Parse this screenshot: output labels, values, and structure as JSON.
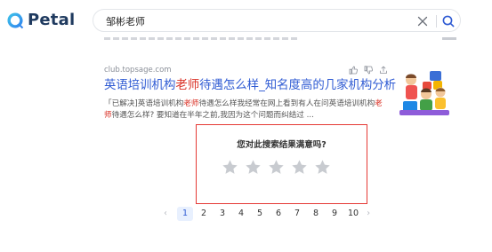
{
  "header": {
    "logo_text": "Petal",
    "search_value": "邹彬老师"
  },
  "result": {
    "url": "club.topsage.com",
    "title_pre": "英语培训机构",
    "title_hl": "老师",
    "title_post": "待遇怎么样_知名度高的几家机构分析",
    "snippet_pre": "「已解决]英语培训机构",
    "snippet_hl1": "老师",
    "snippet_mid": "待遇怎么样我经常在网上看到有人在问英语培训机构",
    "snippet_hl2": "老师",
    "snippet_post": "待遇怎么样? 要知道在半年之前,我因为这个问题而纠结过 ..."
  },
  "survey": {
    "question": "您对此搜索结果满意吗?",
    "star_count": 5,
    "star_color": "#c8cbd0"
  },
  "pagination": {
    "prev": "‹",
    "pages": [
      "1",
      "2",
      "3",
      "4",
      "5",
      "6",
      "7",
      "8",
      "9",
      "10"
    ],
    "current": "1",
    "next": "›"
  },
  "colors": {
    "accent": "#2f5bd3",
    "highlight": "#d93025",
    "survey_border": "#e53935"
  }
}
